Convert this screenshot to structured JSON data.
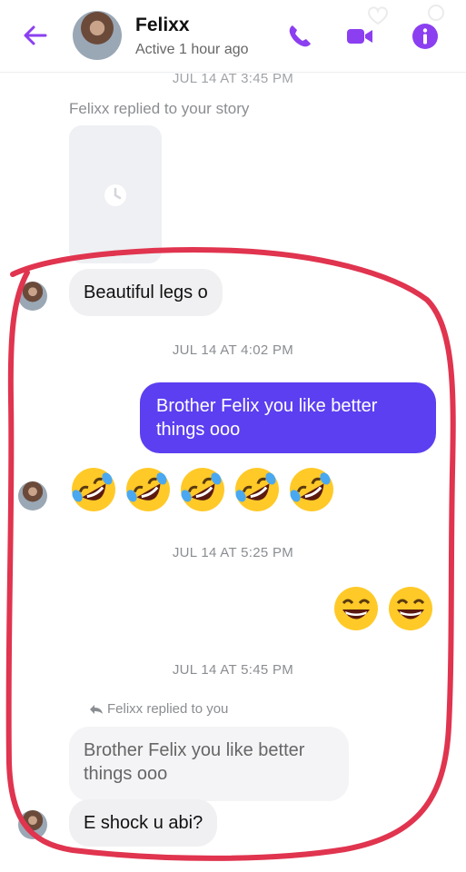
{
  "header": {
    "contact_name": "Felixx",
    "status": "Active 1 hour ago"
  },
  "conversation": {
    "timestamp_top": "JUL 14 AT 3:45 PM",
    "story_reply_note": "Felixx replied to your story",
    "messages": [
      {
        "from": "them",
        "text": "Beautiful legs o"
      },
      {
        "from": "me",
        "text": "Brother Felix you like better things ooo"
      },
      {
        "from": "them",
        "emoji": "rolling-on-floor-laughing",
        "count": 5
      },
      {
        "from": "me",
        "emoji": "grinning-face-with-smiling-eyes",
        "count": 2
      },
      {
        "from": "them",
        "text": "E shock u abi?"
      }
    ],
    "timestamps": [
      "JUL 14 AT 4:02 PM",
      "JUL 14 AT 5:25 PM",
      "JUL 14 AT 5:45 PM"
    ],
    "reply_note": "Felixx replied to you",
    "quoted_text": "Brother Felix you like better things ooo"
  },
  "colors": {
    "accent": "#5b3ff0",
    "incoming_bubble": "#f0f0f2",
    "annotation": "#e0344f"
  }
}
